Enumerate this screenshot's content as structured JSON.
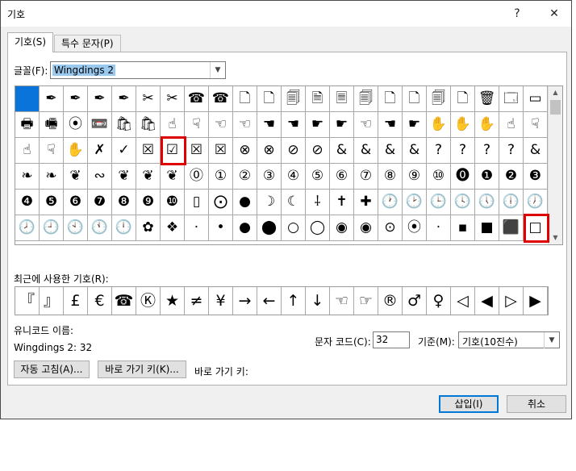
{
  "window": {
    "title": "기호",
    "help_label": "?",
    "close_label": "✕"
  },
  "tabs": [
    {
      "label": "기호(S)"
    },
    {
      "label": "특수 문자(P)"
    }
  ],
  "font": {
    "label": "글꼴(F):",
    "value": "Wingdings 2"
  },
  "grid": {
    "selected_index": 0,
    "cells": [
      "",
      "✒",
      "✒",
      "✒",
      "✒",
      "✂",
      "✂",
      "☎",
      "☎",
      "🗋",
      "🗋",
      "🗐",
      "🗎",
      "🗏",
      "🗐",
      "🗋",
      "🗋",
      "🗐",
      "🗋",
      "🗑",
      "🗔",
      "▭",
      "🖶",
      "🖷",
      "⦿",
      "📼",
      "🛍",
      "🛍",
      "☝",
      "☟",
      "☜",
      "☜",
      "☚",
      "☚",
      "☛",
      "☛",
      "☜",
      "☚",
      "☛",
      "✋",
      "✋",
      "✋",
      "☝",
      "☟",
      "☝",
      "☟",
      "✋",
      "✗",
      "✓",
      "☒",
      "☑",
      "☒",
      "☒",
      "⊗",
      "⊗",
      "⊘",
      "⊘",
      "&",
      "&",
      "&",
      "&",
      "?",
      "?",
      "?",
      "?",
      "&",
      "❧",
      "❧",
      "❦",
      "∾",
      "❦",
      "❦",
      "❦",
      "⓪",
      "①",
      "②",
      "③",
      "④",
      "⑤",
      "⑥",
      "⑦",
      "⑧",
      "⑨",
      "⑩",
      "⓿",
      "❶",
      "❷",
      "❸",
      "❹",
      "❺",
      "❻",
      "❼",
      "❽",
      "❾",
      "❿",
      "▯",
      "⨀",
      "●",
      "☽",
      "☾",
      "⸸",
      "✝",
      "✚",
      "🕐",
      "🕑",
      "🕒",
      "🕓",
      "🕔",
      "🕕",
      "🕖",
      "🕗",
      "🕘",
      "🕙",
      "🕚",
      "🕛",
      "✿",
      "❖",
      "·",
      "•",
      "●",
      "⬤",
      "○",
      "◯",
      "◉",
      "◉",
      "⊙",
      "⦿",
      "·",
      "▪",
      "■",
      "⬛",
      "□"
    ]
  },
  "recent": {
    "label": "최근에 사용한 기호(R):",
    "symbols": [
      "『",
      "』",
      "£",
      "€",
      "☎",
      "Ⓚ",
      "★",
      "≠",
      "¥",
      "→",
      "←",
      "↑",
      "↓",
      "☜",
      "☞",
      "®",
      "♂",
      "♀",
      "◁",
      "◀",
      "▷",
      "▶"
    ]
  },
  "unicode_name": {
    "label": "유니코드 이름:",
    "value": "Wingdings 2: 32"
  },
  "char_code": {
    "label": "문자 코드(C):",
    "value": "32"
  },
  "base": {
    "label": "기준(M):",
    "value": "기호(10진수)"
  },
  "buttons": {
    "autocorrect": "자동 고침(A)...",
    "shortcut_key": "바로 가기 키(K)...",
    "shortcut_label": "바로 가기 키:",
    "insert": "삽입(I)",
    "cancel": "취소"
  },
  "colors": {
    "highlight": "#e00000",
    "selected": "#0a74da",
    "focus": "#0078d7"
  }
}
